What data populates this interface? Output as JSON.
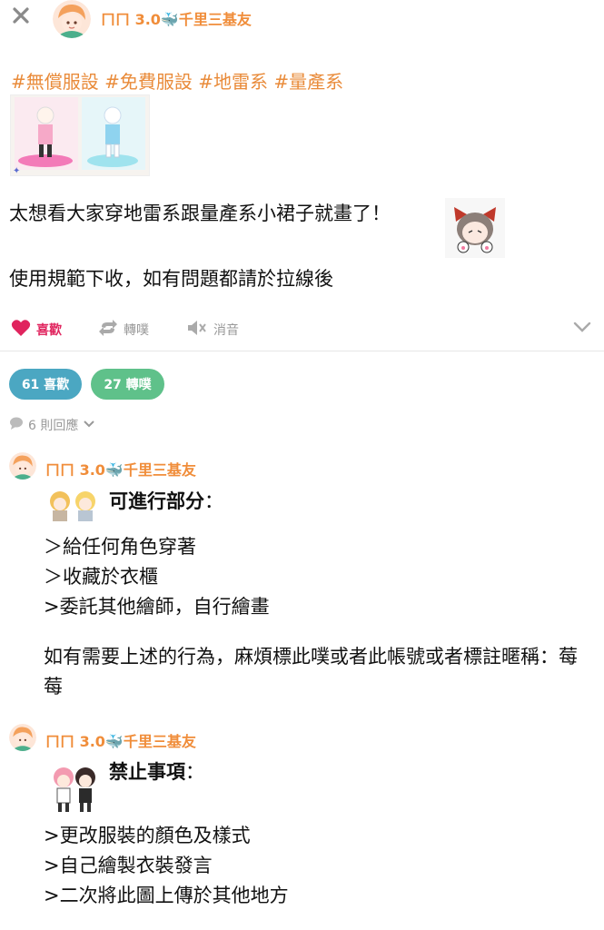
{
  "header": {
    "close_icon": "close-icon",
    "author": {
      "prefix": "ㄇㄇ 3.0",
      "emoji": "whale-icon",
      "suffix": "千里三基友"
    }
  },
  "post": {
    "tags": "#無償服設 #免費服設 #地雷系 #量產系",
    "line1": "太想看大家穿地雷系跟量產系小裙子就畫了！",
    "line2": "使用規範下收，如有問題都請於拉線後"
  },
  "actions": {
    "like_label": "喜歡",
    "repost_label": "轉噗",
    "mute_label": "消音",
    "colors": {
      "like": "#e0245e",
      "muted": "#999999"
    }
  },
  "stats": {
    "likes": "61 喜歡",
    "reposts": "27 轉噗"
  },
  "replies": {
    "label": "6 則回應"
  },
  "comments": [
    {
      "author": {
        "prefix": "ㄇㄇ 3.0",
        "suffix": "千里三基友"
      },
      "heading": "可進行部分",
      "heading_colon": "：",
      "lines": [
        "＞給任何角色穿著",
        "＞收藏於衣櫃",
        ">委託其他繪師，自行繪畫"
      ],
      "paragraph": "如有需要上述的行為，麻煩標此噗或者此帳號或者標註暱稱：莓莓"
    },
    {
      "author": {
        "prefix": "ㄇㄇ 3.0",
        "suffix": "千里三基友"
      },
      "heading": "禁止事項",
      "heading_colon": "：",
      "lines": [
        ">更改服裝的顏色及樣式",
        ">自己繪製衣裝發言",
        ">二次將此圖上傳於其他地方"
      ]
    }
  ],
  "colors": {
    "accent": "#f08d3a",
    "likes_pill": "#4ba7c2",
    "reposts_pill": "#5fc18a"
  }
}
